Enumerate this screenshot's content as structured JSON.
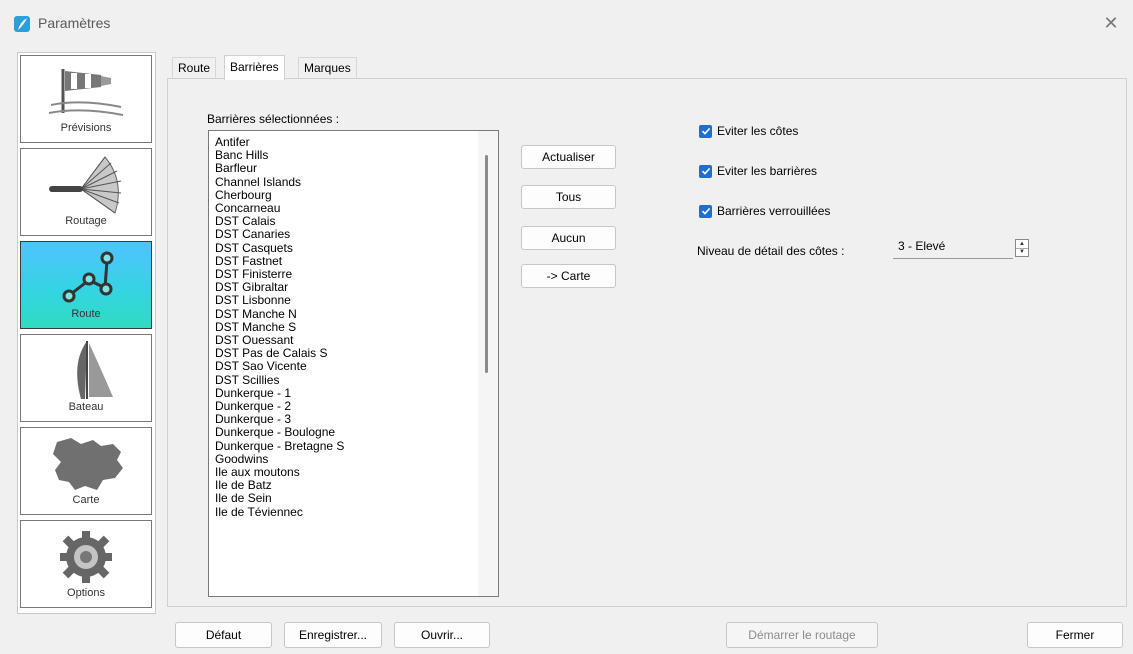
{
  "window": {
    "title": "Paramètres"
  },
  "sidebar": {
    "items": [
      {
        "label": "Prévisions",
        "icon": "windsock-icon"
      },
      {
        "label": "Routage",
        "icon": "sail-routing-icon"
      },
      {
        "label": "Route",
        "icon": "route-nodes-icon",
        "active": true
      },
      {
        "label": "Bateau",
        "icon": "sailboat-icon"
      },
      {
        "label": "Carte",
        "icon": "map-region-icon"
      },
      {
        "label": "Options",
        "icon": "gear-icon"
      }
    ]
  },
  "tabs": [
    {
      "label": "Route"
    },
    {
      "label": "Barrières",
      "active": true
    },
    {
      "label": "Marques"
    }
  ],
  "barrieres": {
    "list_label": "Barrières sélectionnées :",
    "items": [
      "Antifer",
      "Banc Hills",
      "Barfleur",
      "Channel Islands",
      "Cherbourg",
      "Concarneau",
      "DST Calais",
      "DST Canaries",
      "DST Casquets",
      "DST Fastnet",
      "DST Finisterre",
      "DST Gibraltar",
      "DST Lisbonne",
      "DST Manche N",
      "DST Manche S",
      "DST Ouessant",
      "DST Pas de Calais S",
      "DST Sao Vicente",
      "DST Scillies",
      "Dunkerque - 1",
      "Dunkerque - 2",
      "Dunkerque - 3",
      "Dunkerque - Boulogne",
      "Dunkerque - Bretagne S",
      "Goodwins",
      "Ile aux moutons",
      "Ile de Batz",
      "Ile de Sein",
      "Ile de Téviennec"
    ],
    "buttons": {
      "actualiser": "Actualiser",
      "tous": "Tous",
      "aucun": "Aucun",
      "carte": "-> Carte"
    }
  },
  "options": {
    "eviter_cotes": {
      "label": "Eviter les côtes",
      "checked": true
    },
    "eviter_barrieres": {
      "label": "Eviter les barrières",
      "checked": true
    },
    "barrieres_verrouillees": {
      "label": "Barrières verrouillées",
      "checked": true
    },
    "niveau_detail": {
      "label": "Niveau de détail des côtes :",
      "value": "3 - Elevé"
    }
  },
  "footer": {
    "defaut": "Défaut",
    "enregistrer": "Enregistrer...",
    "ouvrir": "Ouvrir...",
    "demarrer": "Démarrer le routage",
    "fermer": "Fermer"
  },
  "colors": {
    "accent": "#1f6fd1",
    "active_sidebar": "#33d5e0"
  }
}
